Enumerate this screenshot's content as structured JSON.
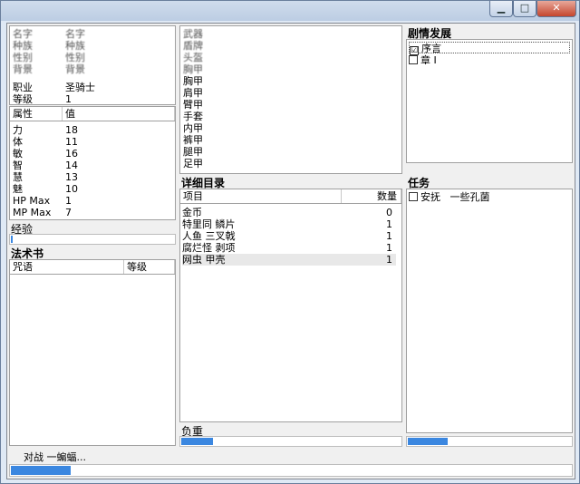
{
  "window": {
    "min_label": "▁",
    "max_label": "□",
    "close_label": "✕"
  },
  "char": {
    "blurred": [
      {
        "k": "名字",
        "v": "名字"
      },
      {
        "k": "种族",
        "v": "种族"
      },
      {
        "k": "性别",
        "v": "性别"
      },
      {
        "k": "背景",
        "v": "背景"
      }
    ],
    "rows": [
      {
        "k": "职业",
        "v": "圣骑士"
      },
      {
        "k": "等级",
        "v": "1"
      }
    ]
  },
  "attributes": {
    "col_attr": "属性",
    "col_val": "值",
    "rows": [
      {
        "k": "力",
        "v": "18"
      },
      {
        "k": "体",
        "v": "11"
      },
      {
        "k": "敏",
        "v": "16"
      },
      {
        "k": "智",
        "v": "14"
      },
      {
        "k": "慧",
        "v": "13"
      },
      {
        "k": "魅",
        "v": "10"
      },
      {
        "k": "HP Max",
        "v": "1"
      },
      {
        "k": "MP Max",
        "v": "7"
      }
    ]
  },
  "experience": {
    "label": "经验",
    "progress": 0.02
  },
  "spellbook": {
    "title": "法术书",
    "col_spell": "咒语",
    "col_level": "等级"
  },
  "equipment": {
    "slots": [
      "武器",
      "盾牌",
      "头盔",
      "胸甲",
      "胸甲",
      "肩甲",
      "臂甲",
      "手套",
      "内甲",
      "裤甲",
      "腿甲",
      "足甲"
    ]
  },
  "inventory": {
    "title": "详细目录",
    "col_item": "项目",
    "col_qty": "数量",
    "items": [
      {
        "name": "金币",
        "qty": "0"
      },
      {
        "name": "特里同 鳞片",
        "qty": "1"
      },
      {
        "name": "人鱼 三叉戟",
        "qty": "1"
      },
      {
        "name": "腐烂怪 剥项",
        "qty": "1"
      },
      {
        "name": "网虫 甲壳",
        "qty": "1"
      }
    ]
  },
  "weight": {
    "label": "负重",
    "progress": 0.15
  },
  "plot": {
    "title": "剧情发展",
    "items": [
      {
        "label": "序言",
        "checked": "☑"
      },
      {
        "label": "章 I",
        "checked": ""
      }
    ]
  },
  "quests": {
    "title": "任务",
    "items": [
      {
        "label": "安抚",
        "detail": "一些孔菌"
      }
    ],
    "progress": 0.25
  },
  "status": {
    "text": "对战  一蝙蝠...",
    "progress": 0.11
  }
}
